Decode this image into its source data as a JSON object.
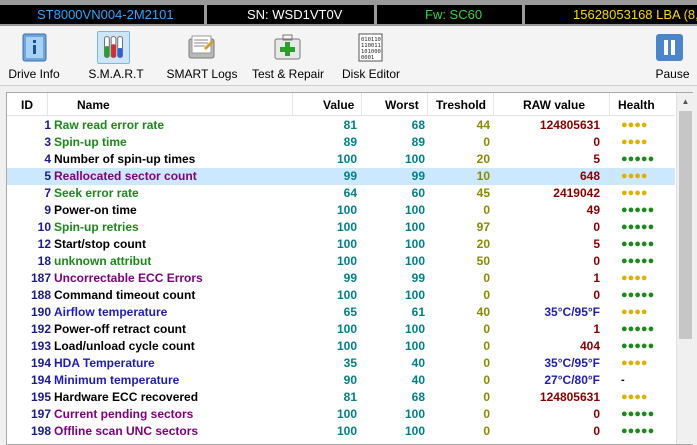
{
  "status": {
    "model": "ST8000VN004-2M2101",
    "serial": "SN: WSD1VT0V",
    "firmware": "Fw: SC60",
    "lba": "15628053168 LBA (8,0"
  },
  "toolbar": {
    "drive_info": "Drive Info",
    "smart": "S.M.A.R.T",
    "smart_logs": "SMART Logs",
    "test_repair": "Test & Repair",
    "disk_editor": "Disk Editor",
    "pause": "Pause"
  },
  "table": {
    "headers": {
      "id": "ID",
      "name": "Name",
      "value": "Value",
      "worst": "Worst",
      "threshold": "Treshold",
      "raw": "RAW value",
      "health": "Health"
    },
    "rows": [
      {
        "id": "1",
        "name": "Raw read error rate",
        "value": "81",
        "worst": "68",
        "threshold": "44",
        "raw": "124805631",
        "health": "●●●●",
        "name_color": "green",
        "health_color": "yellow"
      },
      {
        "id": "3",
        "name": "Spin-up time",
        "value": "89",
        "worst": "89",
        "threshold": "0",
        "raw": "0",
        "health": "●●●●",
        "name_color": "green",
        "health_color": "yellow"
      },
      {
        "id": "4",
        "name": "Number of spin-up times",
        "value": "100",
        "worst": "100",
        "threshold": "20",
        "raw": "5",
        "health": "●●●●●",
        "name_color": "black",
        "health_color": "green"
      },
      {
        "id": "5",
        "name": "Reallocated sector count",
        "value": "99",
        "worst": "99",
        "threshold": "10",
        "raw": "648",
        "health": "●●●●",
        "name_color": "purple",
        "health_color": "yellow",
        "selected": true
      },
      {
        "id": "7",
        "name": "Seek error rate",
        "value": "64",
        "worst": "60",
        "threshold": "45",
        "raw": "2419042",
        "health": "●●●●",
        "name_color": "green",
        "health_color": "yellow"
      },
      {
        "id": "9",
        "name": "Power-on time",
        "value": "100",
        "worst": "100",
        "threshold": "0",
        "raw": "49",
        "health": "●●●●●",
        "name_color": "black",
        "health_color": "green"
      },
      {
        "id": "10",
        "name": "Spin-up retries",
        "value": "100",
        "worst": "100",
        "threshold": "97",
        "raw": "0",
        "health": "●●●●●",
        "name_color": "green",
        "health_color": "green"
      },
      {
        "id": "12",
        "name": "Start/stop count",
        "value": "100",
        "worst": "100",
        "threshold": "20",
        "raw": "5",
        "health": "●●●●●",
        "name_color": "black",
        "health_color": "green"
      },
      {
        "id": "18",
        "name": "unknown attribut",
        "value": "100",
        "worst": "100",
        "threshold": "50",
        "raw": "0",
        "health": "●●●●●",
        "name_color": "green",
        "health_color": "green"
      },
      {
        "id": "187",
        "name": "Uncorrectable ECC Errors",
        "value": "99",
        "worst": "99",
        "threshold": "0",
        "raw": "1",
        "health": "●●●●",
        "name_color": "purple",
        "health_color": "yellow"
      },
      {
        "id": "188",
        "name": "Command timeout count",
        "value": "100",
        "worst": "100",
        "threshold": "0",
        "raw": "0",
        "health": "●●●●●",
        "name_color": "black",
        "health_color": "green"
      },
      {
        "id": "190",
        "name": "Airflow temperature",
        "value": "65",
        "worst": "61",
        "threshold": "40",
        "raw": "35°C/95°F",
        "health": "●●●●",
        "name_color": "blue",
        "health_color": "yellow",
        "raw_color": "blue"
      },
      {
        "id": "192",
        "name": "Power-off retract count",
        "value": "100",
        "worst": "100",
        "threshold": "0",
        "raw": "1",
        "health": "●●●●●",
        "name_color": "black",
        "health_color": "green"
      },
      {
        "id": "193",
        "name": "Load/unload cycle count",
        "value": "100",
        "worst": "100",
        "threshold": "0",
        "raw": "404",
        "health": "●●●●●",
        "name_color": "black",
        "health_color": "green"
      },
      {
        "id": "194",
        "name": "HDA Temperature",
        "value": "35",
        "worst": "40",
        "threshold": "0",
        "raw": "35°C/95°F",
        "health": "●●●●",
        "name_color": "blue",
        "health_color": "yellow",
        "raw_color": "blue"
      },
      {
        "id": "194",
        "name": "Minimum temperature",
        "value": "90",
        "worst": "40",
        "threshold": "0",
        "raw": "27°C/80°F",
        "health": "-",
        "name_color": "blue",
        "health_color": "none",
        "raw_color": "blue"
      },
      {
        "id": "195",
        "name": "Hardware ECC recovered",
        "value": "81",
        "worst": "68",
        "threshold": "0",
        "raw": "124805631",
        "health": "●●●●",
        "name_color": "black",
        "health_color": "yellow"
      },
      {
        "id": "197",
        "name": "Current pending sectors",
        "value": "100",
        "worst": "100",
        "threshold": "0",
        "raw": "0",
        "health": "●●●●●",
        "name_color": "purple",
        "health_color": "green"
      },
      {
        "id": "198",
        "name": "Offline scan UNC sectors",
        "value": "100",
        "worst": "100",
        "threshold": "0",
        "raw": "0",
        "health": "●●●●●",
        "name_color": "purple",
        "health_color": "green"
      }
    ]
  },
  "colors": {
    "selected_row": "#cce8ff",
    "value": "#00808a",
    "threshold": "#8a8a00",
    "raw": "#8a0000",
    "id": "#1a1a8c"
  }
}
